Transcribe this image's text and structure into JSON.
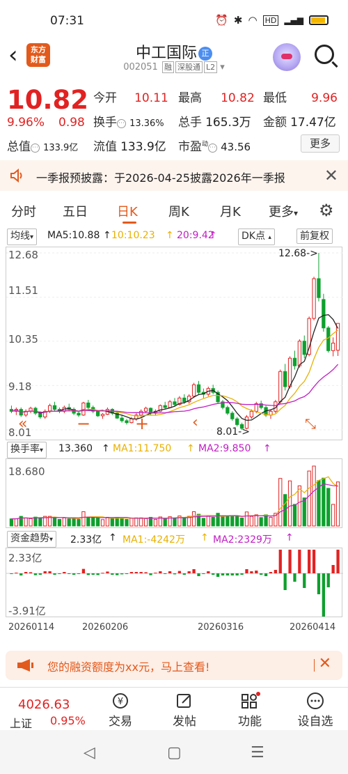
{
  "status": {
    "time": "07:31",
    "icons": [
      "alarm-icon",
      "bluetooth-icon",
      "wifi-icon",
      "hd-icon",
      "4g-icon",
      "signal-icon",
      "battery-icon"
    ]
  },
  "header": {
    "logo": "东方\n财富",
    "title": "中工国际",
    "badge": "正",
    "code": "002051",
    "tags": [
      "融",
      "深股通",
      "L2"
    ]
  },
  "quote": {
    "price": "10.82",
    "change_pct": "9.96%",
    "change": "0.98",
    "total_value_label": "总值",
    "total_value": "133.9亿",
    "open_label": "今开",
    "open": "10.11",
    "high_label": "最高",
    "high": "10.82",
    "low_label": "最低",
    "low": "9.96",
    "turnover_label": "换手",
    "turnover": "13.36%",
    "volume_label": "总手",
    "volume": "165.3万",
    "amount_label": "金额",
    "amount": "17.47亿",
    "float_label": "流值",
    "float_value": "133.9亿",
    "pe_label": "市盈",
    "pe_sup": "动",
    "pe": "43.56",
    "more": "更多"
  },
  "notice": {
    "text": "一季报预披露：于2026-04-25披露2026年一季报"
  },
  "tabs": [
    "分时",
    "五日",
    "日K",
    "周K",
    "月K",
    "更多"
  ],
  "active_tab": "日K",
  "ma_row": {
    "selector": "均线",
    "ma5": "MA5:10.88",
    "ma10": "10:10.23",
    "ma20": "20:9.42",
    "dk": "DK点",
    "fq": "前复权"
  },
  "kline": {
    "y_ticks": [
      "12.68",
      "11.51",
      "10.35",
      "9.18",
      "8.01"
    ],
    "max_label": "12.68->",
    "min_label": "8.01->"
  },
  "turnover_ind": {
    "name": "换手率",
    "value": "13.360",
    "ma1": "MA1:11.750",
    "ma2": "MA2:9.850",
    "max_tick": "18.680"
  },
  "fund_ind": {
    "name": "资金趋势",
    "value": "2.33亿",
    "ma1": "MA1:-4242万",
    "ma2": "MA2:2329万",
    "top_tick": "2.33亿",
    "bottom_tick": "-3.91亿"
  },
  "x_dates": [
    "20260114",
    "20260206",
    "20260316",
    "20260414"
  ],
  "promo": {
    "text": "您的融资额度为xx元，马上查看!"
  },
  "bottom": {
    "index_value": "4026.63",
    "index_name": "上证",
    "index_change": "0.95%",
    "tools": [
      {
        "icon": "yen-icon",
        "label": "交易"
      },
      {
        "icon": "edit-icon",
        "label": "发帖"
      },
      {
        "icon": "grid-icon",
        "label": "功能"
      },
      {
        "icon": "more-icon",
        "label": "设自选"
      }
    ]
  },
  "colors": {
    "up": "#e12222",
    "down": "#0ea02e",
    "accent": "#e25a1c",
    "ma5": "#222222",
    "ma10": "#e8b100",
    "ma20": "#c21ec4"
  },
  "chart_data": {
    "type": "candlestick",
    "ylim": [
      8.01,
      12.68
    ],
    "ohlc": [
      [
        8.55,
        8.65,
        8.45,
        8.5
      ],
      [
        8.5,
        8.6,
        8.4,
        8.55
      ],
      [
        8.55,
        8.6,
        8.35,
        8.4
      ],
      [
        8.4,
        8.55,
        8.35,
        8.5
      ],
      [
        8.5,
        8.62,
        8.45,
        8.58
      ],
      [
        8.58,
        8.62,
        8.4,
        8.45
      ],
      [
        8.45,
        8.5,
        8.3,
        8.35
      ],
      [
        8.35,
        8.55,
        8.3,
        8.5
      ],
      [
        8.5,
        8.7,
        8.45,
        8.65
      ],
      [
        8.65,
        8.75,
        8.5,
        8.55
      ],
      [
        8.55,
        8.6,
        8.45,
        8.5
      ],
      [
        8.5,
        8.65,
        8.45,
        8.6
      ],
      [
        8.6,
        8.7,
        8.5,
        8.55
      ],
      [
        8.55,
        8.6,
        8.4,
        8.45
      ],
      [
        8.45,
        8.5,
        8.35,
        8.4
      ],
      [
        8.4,
        8.75,
        8.38,
        8.72
      ],
      [
        8.72,
        8.8,
        8.55,
        8.6
      ],
      [
        8.6,
        8.65,
        8.45,
        8.5
      ],
      [
        8.5,
        8.52,
        8.35,
        8.38
      ],
      [
        8.38,
        8.45,
        8.3,
        8.42
      ],
      [
        8.42,
        8.6,
        8.4,
        8.55
      ],
      [
        8.55,
        8.58,
        8.4,
        8.45
      ],
      [
        8.45,
        8.5,
        8.3,
        8.32
      ],
      [
        8.32,
        8.4,
        8.2,
        8.25
      ],
      [
        8.25,
        8.3,
        8.15,
        8.2
      ],
      [
        8.2,
        8.35,
        8.18,
        8.3
      ],
      [
        8.3,
        8.45,
        8.25,
        8.4
      ],
      [
        8.4,
        8.55,
        8.35,
        8.5
      ],
      [
        8.5,
        8.62,
        8.45,
        8.58
      ],
      [
        8.58,
        8.6,
        8.4,
        8.45
      ],
      [
        8.45,
        8.55,
        8.4,
        8.5
      ],
      [
        8.5,
        8.68,
        8.48,
        8.65
      ],
      [
        8.65,
        8.75,
        8.55,
        8.6
      ],
      [
        8.6,
        8.8,
        8.58,
        8.75
      ],
      [
        8.75,
        8.85,
        8.62,
        8.68
      ],
      [
        8.68,
        8.9,
        8.65,
        8.85
      ],
      [
        8.85,
        8.95,
        8.7,
        8.75
      ],
      [
        8.75,
        8.95,
        8.7,
        8.9
      ],
      [
        8.9,
        9.25,
        8.85,
        9.2
      ],
      [
        9.2,
        9.3,
        8.95,
        9.0
      ],
      [
        9.0,
        9.1,
        8.85,
        8.95
      ],
      [
        8.95,
        9.15,
        8.9,
        9.1
      ],
      [
        9.1,
        9.2,
        8.95,
        9.0
      ],
      [
        9.0,
        9.05,
        8.7,
        8.75
      ],
      [
        8.75,
        8.8,
        8.55,
        8.6
      ],
      [
        8.6,
        8.65,
        8.4,
        8.45
      ],
      [
        8.45,
        8.5,
        8.25,
        8.3
      ],
      [
        8.3,
        8.35,
        8.1,
        8.15
      ],
      [
        8.15,
        8.2,
        8.01,
        8.05
      ],
      [
        8.05,
        8.4,
        8.02,
        8.35
      ],
      [
        8.35,
        8.55,
        8.3,
        8.5
      ],
      [
        8.5,
        8.75,
        8.45,
        8.7
      ],
      [
        8.7,
        8.78,
        8.55,
        8.6
      ],
      [
        8.6,
        8.65,
        8.35,
        8.4
      ],
      [
        8.4,
        8.55,
        8.3,
        8.5
      ],
      [
        8.5,
        8.8,
        8.45,
        8.75
      ],
      [
        8.75,
        9.6,
        8.7,
        9.55
      ],
      [
        9.55,
        9.75,
        9.05,
        9.15
      ],
      [
        9.15,
        9.95,
        9.1,
        9.9
      ],
      [
        9.9,
        10.1,
        9.6,
        9.7
      ],
      [
        9.7,
        10.4,
        9.65,
        10.35
      ],
      [
        10.35,
        10.5,
        9.9,
        10.0
      ],
      [
        10.0,
        11.0,
        9.95,
        10.95
      ],
      [
        10.95,
        12.05,
        10.9,
        12.0
      ],
      [
        12.0,
        12.68,
        11.4,
        11.5
      ],
      [
        11.45,
        11.6,
        10.6,
        10.7
      ],
      [
        10.7,
        10.75,
        10.05,
        10.1
      ],
      [
        10.1,
        10.45,
        9.95,
        10.3
      ],
      [
        10.11,
        10.82,
        9.96,
        10.82
      ]
    ]
  }
}
